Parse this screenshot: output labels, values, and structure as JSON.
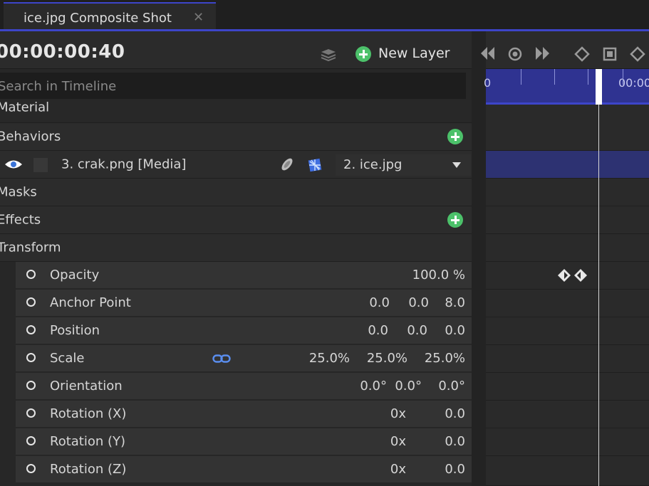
{
  "tab": {
    "title": "ice.jpg Composite Shot",
    "close": "✕"
  },
  "header": {
    "timecode": "00:00:00:40",
    "new_layer_label": "New Layer"
  },
  "search": {
    "placeholder": "Search in Timeline"
  },
  "sections": {
    "material": "Material",
    "behaviors": "Behaviors",
    "masks": "Masks",
    "effects": "Effects",
    "transform": "Transform"
  },
  "layer": {
    "name": "3. crak.png [Media]",
    "blend_source": "2. ice.jpg"
  },
  "properties": [
    {
      "label": "Opacity",
      "values": [
        "100.0 %"
      ]
    },
    {
      "label": "Anchor Point",
      "values": [
        "0.0",
        "0.0",
        "8.0"
      ]
    },
    {
      "label": "Position",
      "values": [
        "0.0",
        "0.0",
        "0.0"
      ]
    },
    {
      "label": "Scale",
      "values": [
        "25.0%",
        "25.0%",
        "25.0%"
      ]
    },
    {
      "label": "Orientation",
      "values": [
        "0.0°",
        "0.0°",
        "0.0°"
      ]
    },
    {
      "label": "Rotation (X)",
      "values": [
        "0x",
        "0.0"
      ]
    },
    {
      "label": "Rotation (Y)",
      "values": [
        "0x",
        "0.0"
      ]
    },
    {
      "label": "Rotation (Z)",
      "values": [
        "0x",
        "0.0"
      ]
    }
  ],
  "timeline": {
    "ruler_start": "0",
    "ruler_label": "00:00"
  },
  "colors": {
    "accent": "#3d45c9",
    "add": "#4cc16a",
    "ruler": "#2f3391"
  },
  "icons": [
    "layers-icon",
    "plus-circle-icon",
    "previous-keyframe-icon",
    "record-icon",
    "next-keyframe-icon",
    "keyframe-icon",
    "square-icon",
    "eye-icon",
    "link-icon",
    "checker-icon",
    "chevron-down-icon"
  ]
}
